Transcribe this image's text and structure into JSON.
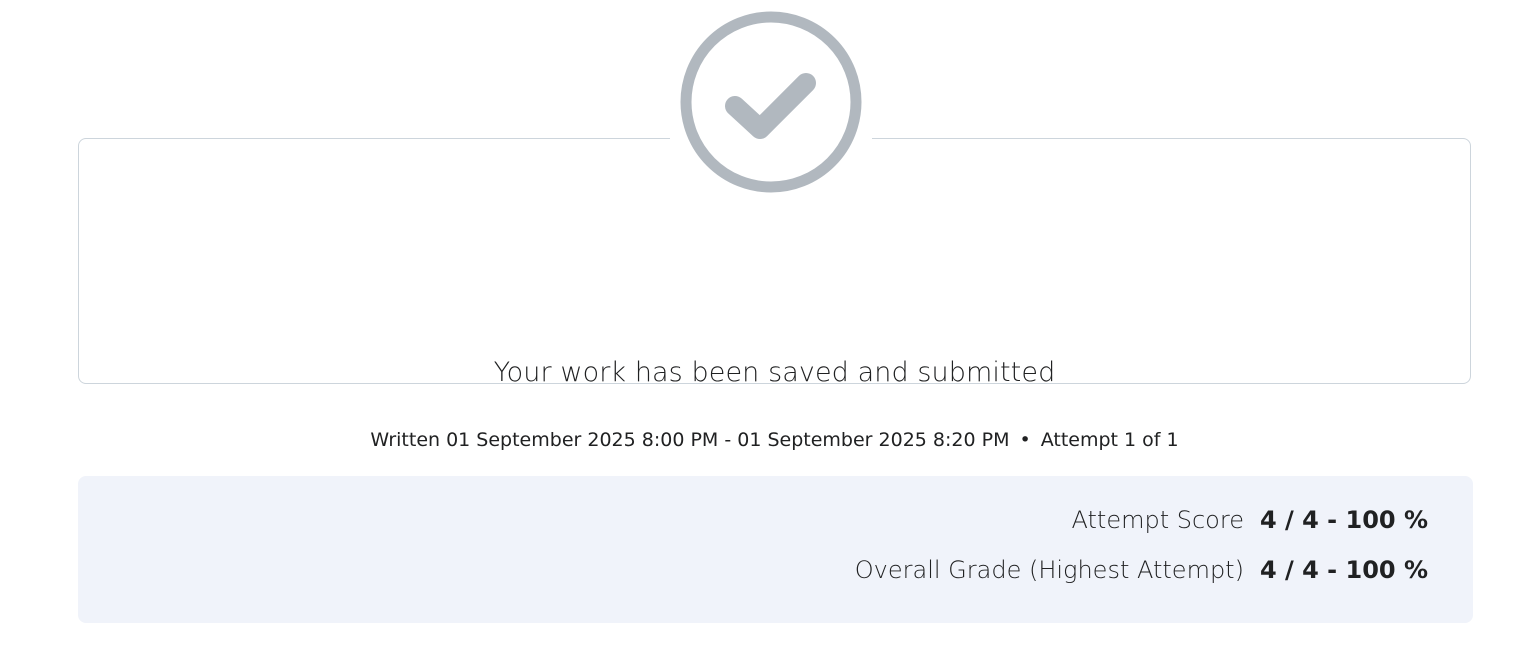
{
  "confirmation": {
    "icon": "check-circle-icon",
    "icon_color": "#b1b8bf",
    "title": "Your work has been saved and submitted",
    "written_text": "Written 01 September 2025 8:00 PM - 01 September 2025 8:20 PM",
    "separator": "•",
    "attempt_text": "Attempt 1 of 1"
  },
  "scores": {
    "panel_color": "#f0f3fa",
    "rows": [
      {
        "label": "Attempt Score",
        "value": "4 / 4 - 100 %"
      },
      {
        "label": "Overall Grade (Highest Attempt)",
        "value": "4 / 4 - 100 %"
      }
    ]
  }
}
